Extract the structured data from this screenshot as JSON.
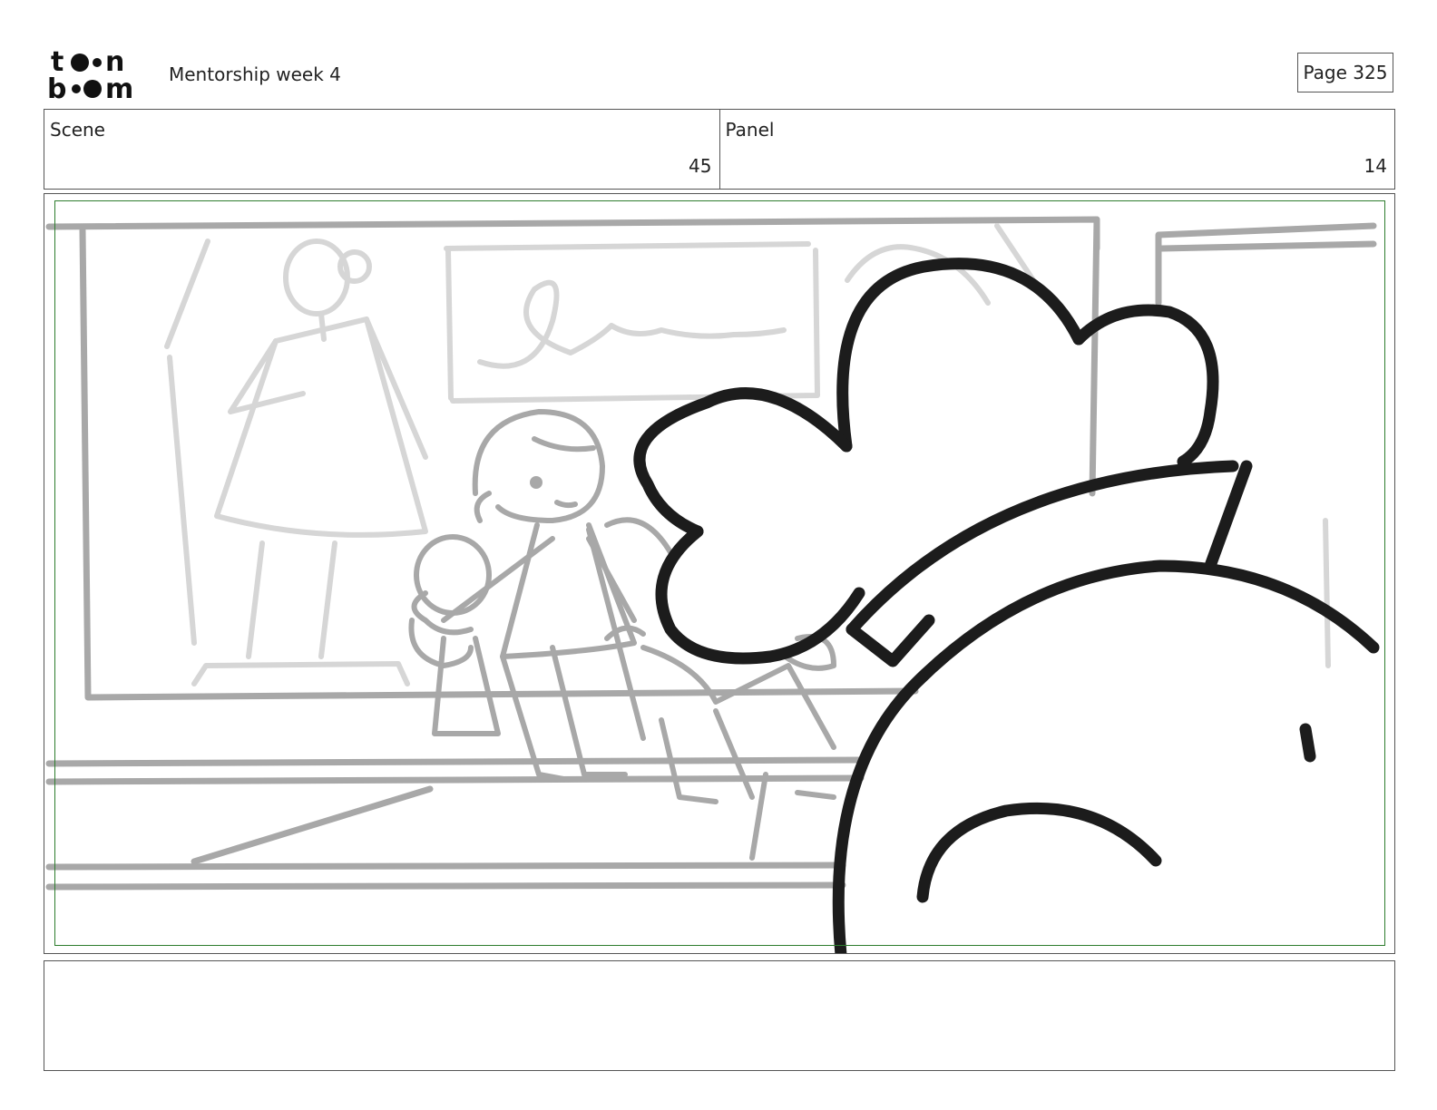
{
  "header": {
    "logo_text": "toon boom",
    "document_title": "Mentorship week 4",
    "page_label": "Page 325"
  },
  "info": {
    "scene_label": "Scene",
    "scene_value": "45",
    "panel_label": "Panel",
    "panel_value": "14"
  },
  "notes": {
    "text": ""
  },
  "colors": {
    "safe_frame": "#2e7d2e",
    "sketch_light": "#d6d6d6",
    "sketch_mid": "#a8a8a8",
    "ink": "#1c1c1c"
  }
}
